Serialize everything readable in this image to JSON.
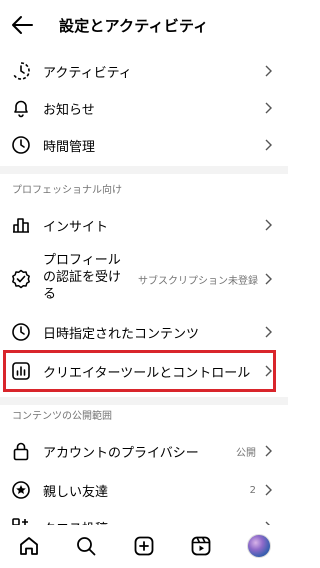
{
  "header": {
    "title": "設定とアクティビティ"
  },
  "rows_top": [
    {
      "label": "アクティビティ",
      "icon": "activity-icon"
    },
    {
      "label": "お知らせ",
      "icon": "bell-icon"
    },
    {
      "label": "時間管理",
      "icon": "clock-icon"
    }
  ],
  "section_pro": {
    "heading": "プロフェッショナル向け"
  },
  "rows_pro": {
    "insights": {
      "label": "インサイト",
      "icon": "bar-chart-icon"
    },
    "verified": {
      "label_line1": "プロフィール",
      "label_line2": "の認証を受け",
      "label_line3": "る",
      "value": "サブスクリプション未登録",
      "icon": "verified-badge-icon"
    },
    "scheduled": {
      "label": "日時指定されたコンテンツ",
      "icon": "clock-icon"
    },
    "creator_tools": {
      "label": "クリエイターツールとコントロール",
      "icon": "chart-box-icon"
    }
  },
  "section_public": {
    "heading": "コンテンツの公開範囲"
  },
  "rows_public": {
    "privacy": {
      "label": "アカウントのプライバシー",
      "value": "公開",
      "icon": "lock-icon"
    },
    "close_friends": {
      "label": "親しい友達",
      "value": "2",
      "icon": "star-circle-icon"
    },
    "crosspost": {
      "label": "クロス投稿",
      "icon": "crosspost-icon"
    }
  },
  "colors": {
    "highlight": "#d9252b",
    "secondary_text": "#737373",
    "separator": "#f3f3f3"
  },
  "bottom_nav": [
    "home-icon",
    "search-icon",
    "create-icon",
    "reels-icon",
    "profile-avatar"
  ]
}
